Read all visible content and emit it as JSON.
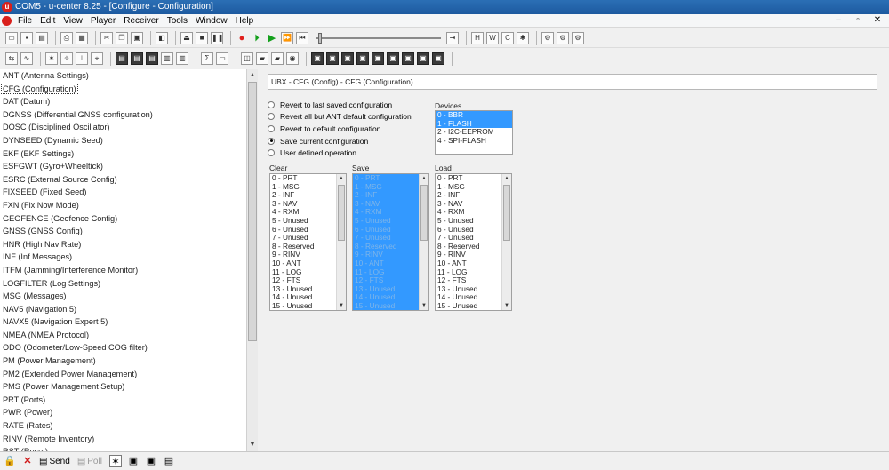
{
  "window": {
    "title": "COM5 - u-center 8.25 - [Configure - Configuration]"
  },
  "menu": [
    "File",
    "Edit",
    "View",
    "Player",
    "Receiver",
    "Tools",
    "Window",
    "Help"
  ],
  "window_controls": [
    "–",
    "▫",
    "✕"
  ],
  "toolbar_main": [
    {
      "icon": "new-file-icon",
      "glyph": "▭"
    },
    {
      "icon": "save-icon",
      "glyph": "▪"
    },
    {
      "icon": "open-icon",
      "glyph": "▤"
    },
    {
      "icon": "print-icon",
      "glyph": "⎙"
    },
    {
      "icon": "print-preview-icon",
      "glyph": "▦"
    },
    {
      "icon": "cut-icon",
      "glyph": "✂"
    },
    {
      "icon": "copy-icon",
      "glyph": "❐"
    },
    {
      "icon": "paste-icon",
      "glyph": "▣"
    },
    {
      "icon": "record-settings-icon",
      "glyph": "◧"
    },
    {
      "icon": "eject-icon",
      "glyph": "⏏"
    },
    {
      "icon": "stop-icon",
      "glyph": "■"
    },
    {
      "icon": "pause-icon",
      "glyph": "❚❚"
    },
    {
      "icon": "record-icon",
      "glyph": "●"
    },
    {
      "icon": "step-forward-icon",
      "glyph": "⏵"
    },
    {
      "icon": "play-icon",
      "glyph": "▶"
    },
    {
      "icon": "fast-forward-icon",
      "glyph": "⏩"
    },
    {
      "icon": "rewind-icon",
      "glyph": "⏮"
    },
    {
      "icon": "end-icon",
      "glyph": "⇥"
    },
    {
      "icon": "hot-start-icon",
      "glyph": "H"
    },
    {
      "icon": "warm-start-icon",
      "glyph": "W"
    },
    {
      "icon": "cold-start-icon",
      "glyph": "C"
    },
    {
      "icon": "reset-icon",
      "glyph": "✱"
    },
    {
      "icon": "gear-icon",
      "glyph": "⚙"
    },
    {
      "icon": "gear-alt-icon",
      "glyph": "⚙"
    },
    {
      "icon": "gear-settings-icon",
      "glyph": "⚙"
    }
  ],
  "toolbar_views": [
    {
      "icon": "connect-icon",
      "glyph": "⇆"
    },
    {
      "icon": "baudrate-icon",
      "glyph": "∿"
    },
    {
      "icon": "autobaud-icon",
      "glyph": "✶"
    },
    {
      "icon": "satellite-icon",
      "glyph": "✧"
    },
    {
      "icon": "antenna-icon",
      "glyph": "⊥"
    },
    {
      "icon": "location-icon",
      "glyph": "⌖"
    },
    {
      "icon": "text-console-icon",
      "glyph": "▤"
    },
    {
      "icon": "packet-console-icon",
      "glyph": "▤"
    },
    {
      "icon": "binary-console-icon",
      "glyph": "▤"
    },
    {
      "icon": "messages-view-icon",
      "glyph": "▥"
    },
    {
      "icon": "statistics-view-icon",
      "glyph": "▥"
    },
    {
      "icon": "configure-view-icon",
      "glyph": "Σ"
    },
    {
      "icon": "table-view-icon",
      "glyph": "▭"
    },
    {
      "icon": "map-view-icon",
      "glyph": "◫"
    },
    {
      "icon": "chart-view-icon",
      "glyph": "▰"
    },
    {
      "icon": "histogram-icon",
      "glyph": "▰"
    },
    {
      "icon": "camera-icon",
      "glyph": "◉"
    },
    {
      "icon": "docking-icon",
      "glyph": "▣"
    },
    {
      "icon": "sky-view-icon",
      "glyph": "▣"
    },
    {
      "icon": "deviation-map-icon",
      "glyph": "▣"
    },
    {
      "icon": "compass-icon",
      "glyph": "▣"
    },
    {
      "icon": "watch-icon",
      "glyph": "▣"
    },
    {
      "icon": "altimeter-icon",
      "glyph": "▣"
    },
    {
      "icon": "speed-icon",
      "glyph": "▣"
    },
    {
      "icon": "satellite-level-icon",
      "glyph": "▣"
    },
    {
      "icon": "data-window-icon",
      "glyph": "▣"
    }
  ],
  "message_list": [
    "ANT (Antenna Settings)",
    "CFG (Configuration)",
    "DAT (Datum)",
    "DGNSS (Differential GNSS configuration)",
    "DOSC (Disciplined Oscillator)",
    "DYNSEED (Dynamic Seed)",
    "EKF (EKF Settings)",
    "ESFGWT (Gyro+Wheeltick)",
    "ESRC (External Source Config)",
    "FIXSEED (Fixed Seed)",
    "FXN (Fix Now Mode)",
    "GEOFENCE (Geofence Config)",
    "GNSS (GNSS Config)",
    "HNR (High Nav Rate)",
    "INF (Inf Messages)",
    "ITFM (Jamming/Interference Monitor)",
    "LOGFILTER (Log Settings)",
    "MSG (Messages)",
    "NAV5 (Navigation 5)",
    "NAVX5 (Navigation Expert 5)",
    "NMEA (NMEA Protocol)",
    "ODO (Odometer/Low-Speed COG filter)",
    "PM (Power Management)",
    "PM2 (Extended Power Management)",
    "PMS (Power Management Setup)",
    "PRT (Ports)",
    "PWR (Power)",
    "RATE (Rates)",
    "RINV (Remote Inventory)",
    "RST (Reset)"
  ],
  "message_list_selected": "CFG (Configuration)",
  "config": {
    "header": "UBX - CFG (Config) - CFG (Configuration)",
    "options": [
      {
        "label": "Revert to last saved configuration",
        "checked": false
      },
      {
        "label": "Revert all but ANT default configuration",
        "checked": false
      },
      {
        "label": "Revert to default configuration",
        "checked": false
      },
      {
        "label": "Save current configuration",
        "checked": true
      },
      {
        "label": "User defined operation",
        "checked": false
      }
    ],
    "devices_label": "Devices",
    "devices": [
      {
        "label": "0 - BBR",
        "selected": true
      },
      {
        "label": "1 - FLASH",
        "selected": true
      },
      {
        "label": "2 - I2C-EEPROM",
        "selected": false
      },
      {
        "label": "4 - SPI-FLASH",
        "selected": false
      }
    ],
    "clear_label": "Clear",
    "save_label": "Save",
    "load_label": "Load",
    "sections": [
      "0 - PRT",
      "1 - MSG",
      "2 - INF",
      "3 - NAV",
      "4 - RXM",
      "5 - Unused",
      "6 - Unused",
      "7 - Unused",
      "8 - Reserved",
      "9 - RINV",
      "10 - ANT",
      "11 - LOG",
      "12 - FTS",
      "13 - Unused",
      "14 - Unused",
      "15 - Unused"
    ],
    "save_all_selected": true
  },
  "bottom_bar": {
    "send_label": "Send",
    "poll_label": "Poll"
  },
  "colors": {
    "selection": "#3399ff",
    "titlebar": "#2b6fb5",
    "record": "#e0201c",
    "play": "#14a01c"
  }
}
